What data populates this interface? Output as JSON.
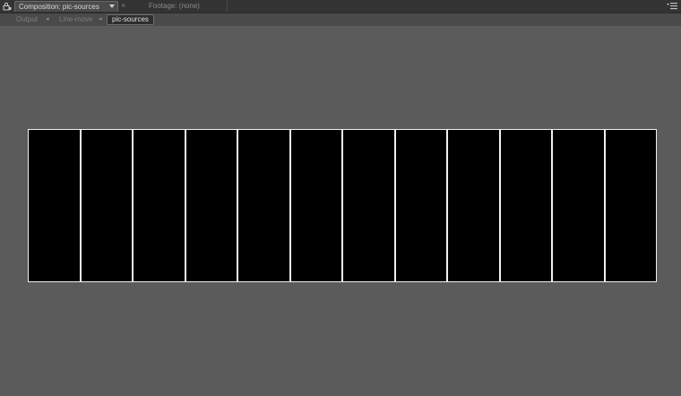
{
  "tabs": {
    "active_label": "Composition: pic-sources",
    "inactive_label": "Footage: (none)"
  },
  "breadcrumbs": [
    {
      "label": "Output"
    },
    {
      "label": "Line-move"
    },
    {
      "label": "pic-sources"
    }
  ],
  "viewer": {
    "slice_count": 12,
    "background_color": "#5b5b5b",
    "frame_color": "#000000",
    "border_color": "#f0f0f0"
  },
  "icons": {
    "lock": "lock-icon",
    "dropdown": "chevron-down-icon",
    "close": "close-icon",
    "panel_menu": "panel-menu-icon"
  }
}
